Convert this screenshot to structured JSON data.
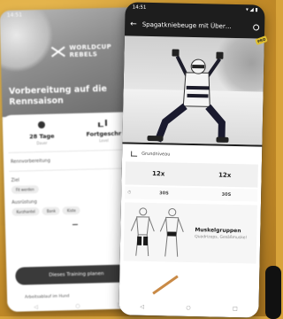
{
  "back_phone": {
    "status_time": "14:51",
    "logo": "WORLDCUP REBELS",
    "headline": "Vorbereitung auf die Rennsaison",
    "stats": [
      {
        "value": "28 Tage",
        "label": "Dauer",
        "icon": "calendar-icon"
      },
      {
        "value": "Fortgeschr",
        "label": "Level",
        "icon": "level-bars-icon"
      }
    ],
    "sections": {
      "trainingsgestaltung": "Rennvorbereitung",
      "ziel": "Ziel",
      "ziel_chips": [
        "Fit werden"
      ],
      "ausruestung": "Ausrüstung",
      "ausruestung_chips": [
        "Kurzhantel",
        "Bank",
        "Kiste"
      ]
    },
    "primary_button": "Dieses Training planen",
    "footer": "Arbeitsablauf im Hund"
  },
  "front_phone": {
    "status_time": "14:51",
    "title": "Spagatkniebeuge mit Über…",
    "level": "Grundniveau",
    "sets": [
      "12x",
      "12x"
    ],
    "rest": [
      "30S",
      "30S"
    ],
    "muscle_title": "Muskelgruppen",
    "muscle_sub": "Quadrizeps, Gesäßmuskel",
    "badge": "PRO"
  }
}
